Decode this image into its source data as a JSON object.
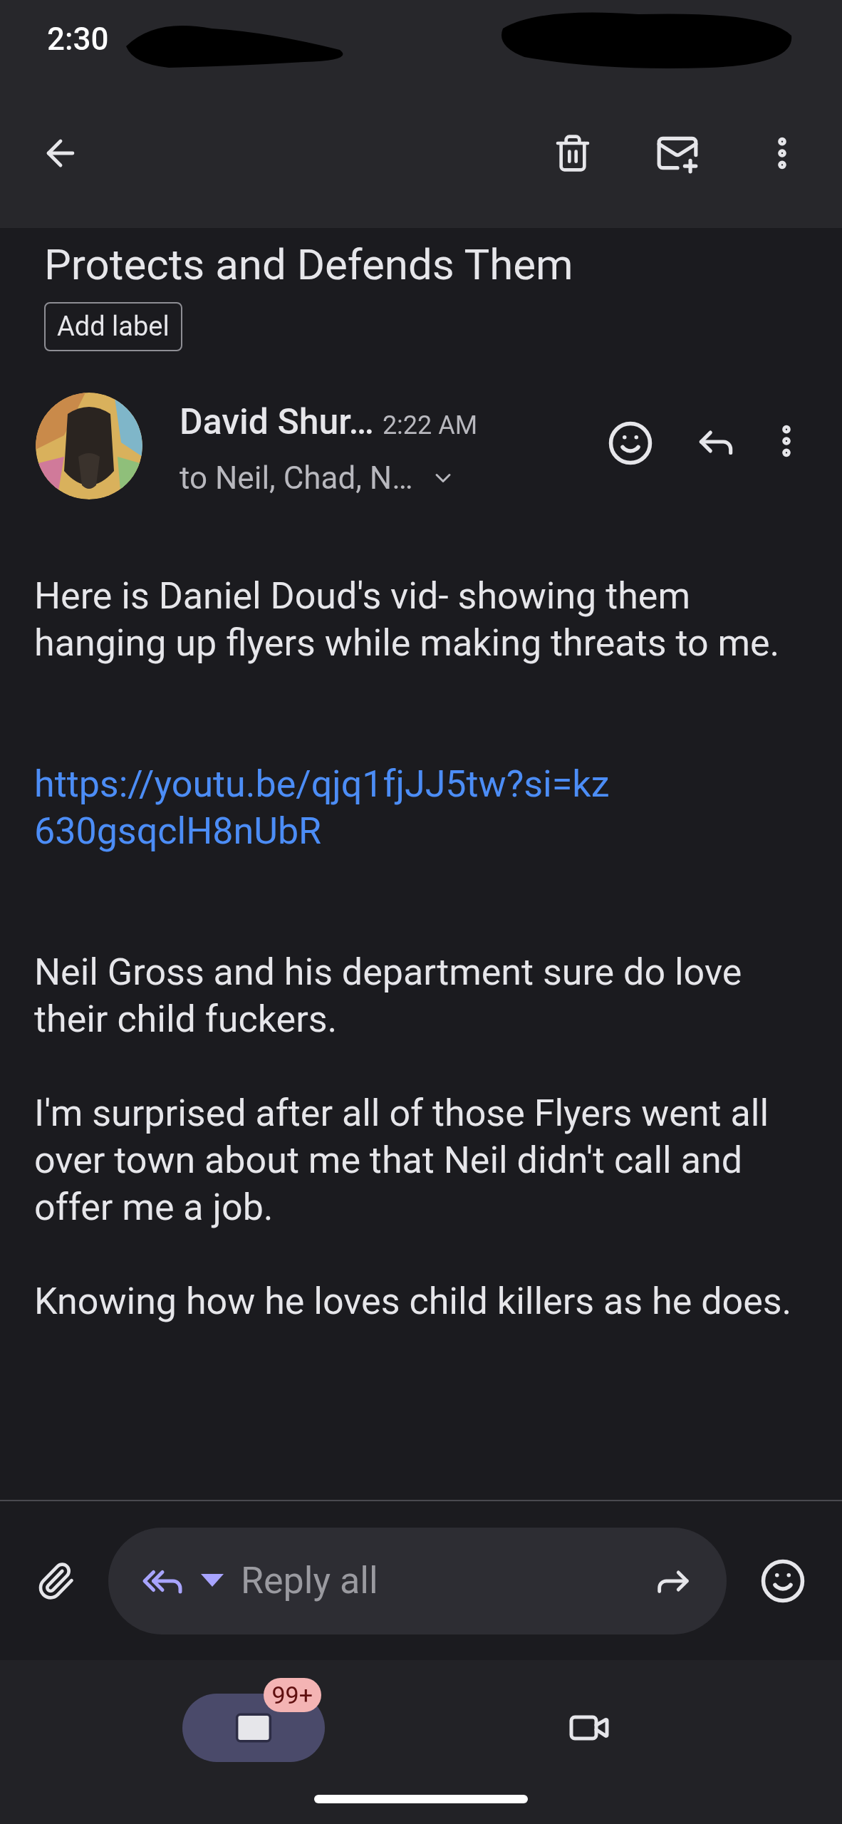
{
  "status_bar": {
    "time": "2:30"
  },
  "subject": "Protects and Defends Them",
  "label_button": "Add label",
  "message": {
    "sender": "David Shur…",
    "time": "2:22 AM",
    "recipients": "to Neil, Chad, N…",
    "body": [
      {
        "kind": "text",
        "text": "Here is Daniel Doud's vid- showing them hanging up flyers while making threats to me."
      },
      {
        "kind": "gap"
      },
      {
        "kind": "link",
        "text": "https://youtu.be/qjq1fjJJ5tw?si=kz630gsqclH8nUbR"
      },
      {
        "kind": "gap"
      },
      {
        "kind": "text",
        "text": "Neil Gross and his department sure do love their child fuckers."
      },
      {
        "kind": "text",
        "text": "I'm surprised after all of those Flyers went all over town about me that Neil didn't call and offer me a job."
      },
      {
        "kind": "text",
        "text": "Knowing how he loves child killers as he does."
      }
    ]
  },
  "reply_bar": {
    "label": "Reply all"
  },
  "bottom_nav": [
    {
      "kind": "mail",
      "badge": "99+",
      "selected": true
    },
    {
      "kind": "video",
      "selected": false
    }
  ]
}
